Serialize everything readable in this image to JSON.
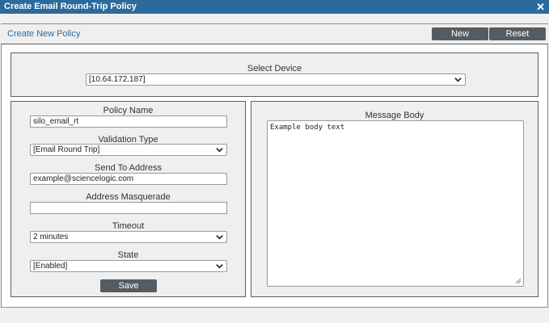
{
  "dialog": {
    "title": "Create Email Round-Trip Policy",
    "close_glyph": "✕"
  },
  "header": {
    "title": "Create New Policy",
    "new_label": "New",
    "reset_label": "Reset"
  },
  "device": {
    "label": "Select Device",
    "value": "[10.64.172.187]"
  },
  "form": {
    "policy_name_label": "Policy Name",
    "policy_name_value": "silo_email_rt",
    "validation_type_label": "Validation Type",
    "validation_type_value": "[Email Round Trip]",
    "send_to_label": "Send To Address",
    "send_to_value": "example@sciencelogic.com",
    "masquerade_label": "Address Masquerade",
    "masquerade_value": "",
    "timeout_label": "Timeout",
    "timeout_value": "2 minutes",
    "state_label": "State",
    "state_value": "[Enabled]",
    "save_label": "Save"
  },
  "message": {
    "label": "Message Body",
    "value": "Example body text"
  },
  "colors": {
    "titlebar": "#2c6a9c",
    "button": "#555c61",
    "panel_bg": "#efefef"
  },
  "icons": {
    "close": "close-icon",
    "dropdown": "chevron-down-icon",
    "resize": "resize-grip-icon"
  }
}
